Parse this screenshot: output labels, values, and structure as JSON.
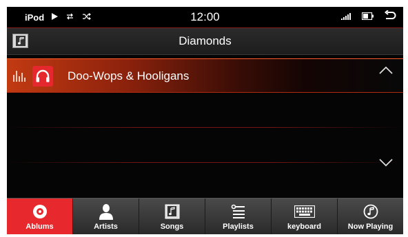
{
  "status": {
    "source": "iPod",
    "play_icon": "play-icon",
    "repeat_icon": "repeat-icon",
    "shuffle_icon": "shuffle-icon",
    "time": "12:00",
    "signal_icon": "signal-icon",
    "battery_icon": "battery-icon",
    "back_icon": "back-arrow-icon"
  },
  "header": {
    "title": "Diamonds",
    "art_icon": "music-note-icon"
  },
  "list": {
    "items": [
      {
        "label": "Doo-Wops & Hooligans",
        "selected": true,
        "icons": [
          "equalizer-icon",
          "headphones-icon"
        ]
      }
    ],
    "scroll_up_icon": "chevron-up-icon",
    "scroll_down_icon": "chevron-down-icon"
  },
  "tabs": [
    {
      "label": "Ablums",
      "icon": "album-disc-icon",
      "active": true
    },
    {
      "label": "Artists",
      "icon": "person-icon",
      "active": false
    },
    {
      "label": "Songs",
      "icon": "music-note-icon",
      "active": false
    },
    {
      "label": "Playlists",
      "icon": "playlist-icon",
      "active": false
    },
    {
      "label": "keyboard",
      "icon": "keyboard-icon",
      "active": false
    },
    {
      "label": "Now Playing",
      "icon": "now-playing-icon",
      "active": false
    }
  ],
  "colors": {
    "accent": "#e7282d",
    "background": "#050505",
    "tab_bg": "#3a3a3a",
    "selection_start": "#c23a12"
  }
}
